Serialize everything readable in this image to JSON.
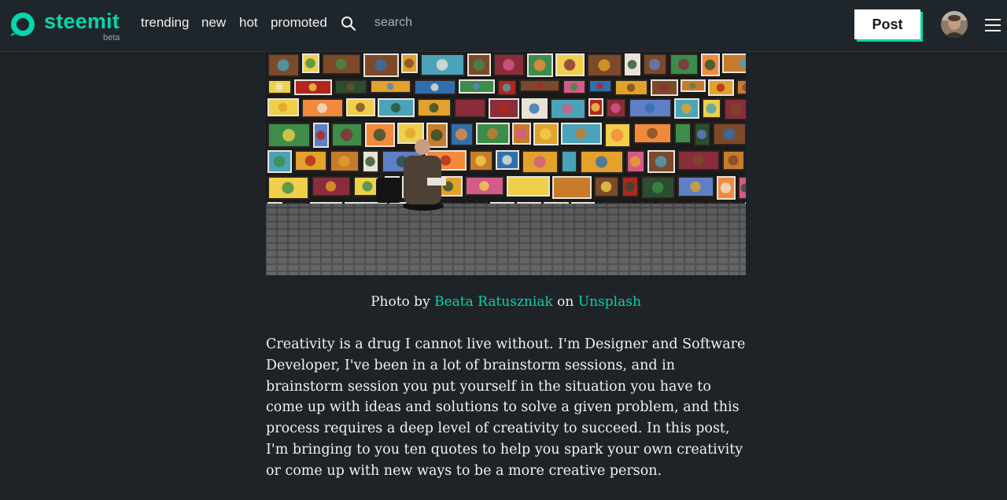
{
  "header": {
    "brand": "steemit",
    "brand_badge": "beta",
    "nav": [
      "trending",
      "new",
      "hot",
      "promoted"
    ],
    "search_placeholder": "search",
    "post_label": "Post",
    "accent_color": "#06d6a9"
  },
  "article": {
    "caption": {
      "prefix": "Photo by",
      "author": "Beata Ratuszniak",
      "mid": "on",
      "source": "Unsplash"
    },
    "paragraph": "Creativity is a drug I cannot live without. I'm Designer and Software Developer, I've been in a lot of brainstorm sessions, and in brainstorm session you put yourself in the situation you have to come up with ideas and solutions to solve a given problem, and this process requires a deep level of creativity to succeed. In this post, I'm bringing to you ten quotes to help you spark your own creativity or come up with new ways to be a more creative person."
  },
  "icons": {
    "logo": "steemit-logo-icon",
    "search": "search-icon",
    "menu": "hamburger-menu-icon"
  }
}
